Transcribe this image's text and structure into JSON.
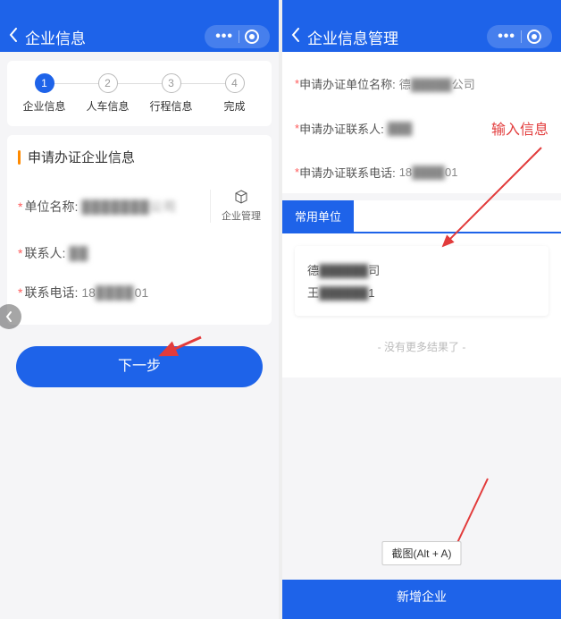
{
  "left": {
    "header": {
      "title": "企业信息"
    },
    "steps": [
      {
        "num": "1",
        "label": "企业信息"
      },
      {
        "num": "2",
        "label": "人车信息"
      },
      {
        "num": "3",
        "label": "行程信息"
      },
      {
        "num": "4",
        "label": "完成"
      }
    ],
    "section_title": "申请办证企业信息",
    "fields": {
      "company_label": "单位名称:",
      "company_value": "███████公司",
      "contact_label": "联系人:",
      "contact_value": "██",
      "phone_label": "联系电话:",
      "phone_value": "18████01"
    },
    "mgmt_label": "企业管理",
    "next_button": "下一步"
  },
  "right": {
    "header": {
      "title": "企业信息管理"
    },
    "fields": {
      "company_label": "申请办证单位名称:",
      "company_value": "德██████公司",
      "contact_label": "申请办证联系人:",
      "contact_value": "███",
      "phone_label": "申请办证联系电话:",
      "phone_value": "18████01"
    },
    "annotation": "输入信息",
    "tab_label": "常用单位",
    "result": {
      "line1": "德██████司",
      "line2": "王██████1"
    },
    "no_more": "- 没有更多结果了 -",
    "tooltip": "截图(Alt + A)",
    "add_button": "新增企业"
  }
}
